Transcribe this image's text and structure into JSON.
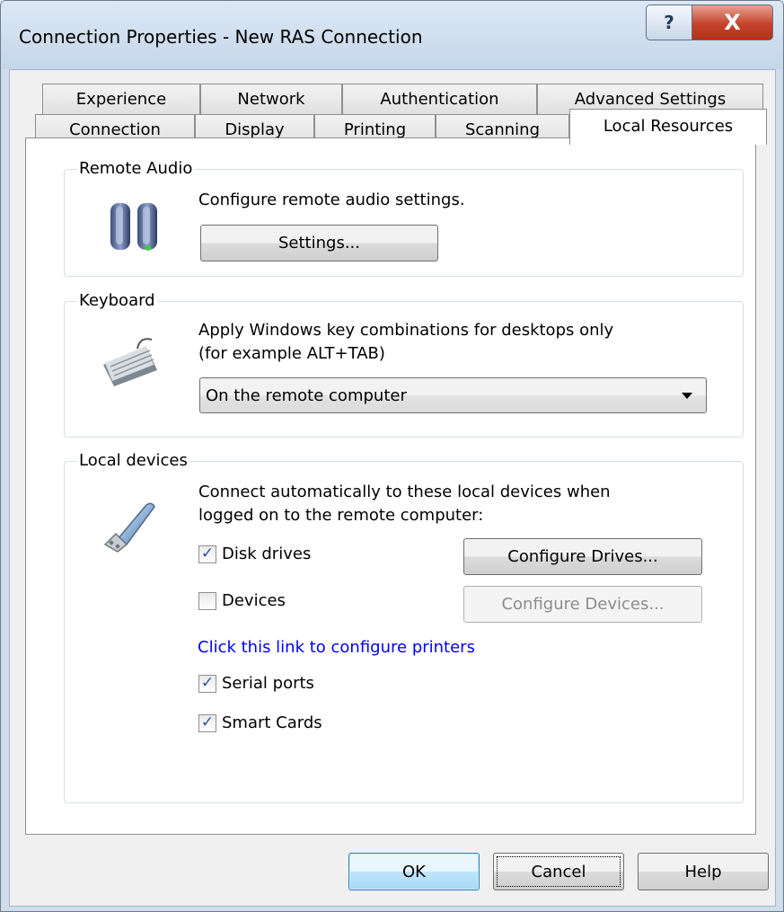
{
  "window": {
    "title": "Connection Properties - New RAS Connection",
    "help_glyph": "?",
    "close_glyph": "X"
  },
  "tabs": {
    "row1": [
      "Experience",
      "Network",
      "Authentication",
      "Advanced Settings"
    ],
    "row2": [
      "Connection",
      "Display",
      "Printing",
      "Scanning",
      "Local Resources"
    ],
    "active": "Local Resources"
  },
  "remote_audio": {
    "label": "Remote Audio",
    "description": "Configure remote audio settings.",
    "settings_button": "Settings...",
    "icon": "speakers-icon"
  },
  "keyboard": {
    "label": "Keyboard",
    "description_line1": "Apply Windows key combinations for desktops only",
    "description_line2": "(for example ALT+TAB)",
    "selected_option": "On the remote computer",
    "icon": "keyboard-icon"
  },
  "local_devices": {
    "label": "Local devices",
    "description_line1": "Connect automatically to these local devices when",
    "description_line2": "logged on to the remote computer:",
    "icon": "usb-drive-icon",
    "disk_drives": {
      "label": "Disk drives",
      "checked": true
    },
    "devices": {
      "label": "Devices",
      "checked": false
    },
    "configure_drives_button": "Configure Drives...",
    "configure_devices_button": "Configure Devices...",
    "printers_link": "Click this link to configure printers",
    "serial_ports": {
      "label": "Serial ports",
      "checked": true
    },
    "smart_cards": {
      "label": "Smart Cards",
      "checked": true
    }
  },
  "footer": {
    "ok": "OK",
    "cancel": "Cancel",
    "help": "Help"
  },
  "colors": {
    "title_gradient_top": "#dde8f4",
    "close_button": "#c4432a",
    "link": "#0000ff",
    "check_mark": "#2a4fa1"
  }
}
